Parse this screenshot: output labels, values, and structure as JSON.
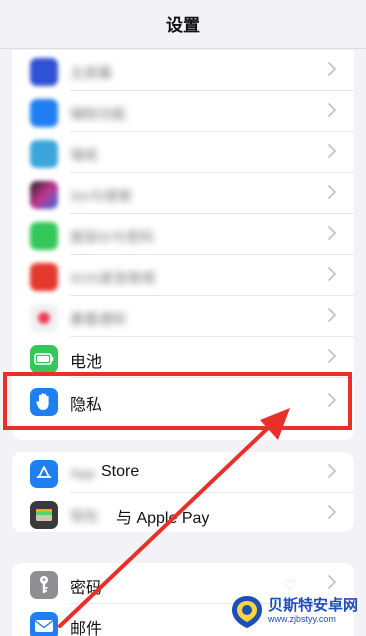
{
  "nav": {
    "title": "设置"
  },
  "group1": {
    "rows": [
      {
        "label": "主屏幕",
        "blurred": true,
        "icon": "home-screen-icon",
        "color": "#2f52d4"
      },
      {
        "label": "辅助功能",
        "blurred": true,
        "icon": "accessibility-icon",
        "color": "#1f7ff1"
      },
      {
        "label": "墙纸",
        "blurred": true,
        "icon": "wallpaper-icon",
        "color": "#3aa6dc"
      },
      {
        "label": "Siri与搜索",
        "blurred": true,
        "icon": "siri-icon",
        "color": "#222222"
      },
      {
        "label": "面容ID与密码",
        "blurred": true,
        "icon": "face-id-icon",
        "color": "#34c759"
      },
      {
        "label": "SOS紧急联络",
        "blurred": true,
        "icon": "sos-icon",
        "color": "#e5392e"
      },
      {
        "label": "暴露通知",
        "blurred": true,
        "icon": "exposure-notification-icon",
        "color": "#f1f1f1"
      },
      {
        "label": "电池",
        "blurred": false,
        "icon": "battery-icon",
        "color": "#34c759"
      },
      {
        "label": "隐私",
        "blurred": false,
        "icon": "privacy-hand-icon",
        "color": "#1f7ff1"
      }
    ]
  },
  "group2": {
    "rows": [
      {
        "label_blur": "App",
        "label": "Store",
        "icon": "app-store-icon",
        "color": "#1f7ff1"
      },
      {
        "label_blur": "钱包",
        "label": "与 Apple Pay",
        "icon": "wallet-icon",
        "color": "#3a3a3a"
      }
    ]
  },
  "group3": {
    "rows": [
      {
        "label": "密码",
        "icon": "key-icon",
        "color": "#8e8e93"
      },
      {
        "label": "邮件",
        "icon": "mail-icon",
        "color": "#1f7ff1"
      }
    ]
  },
  "watermark": {
    "title": "贝斯特安卓网",
    "url": "www.zjbstyy.com"
  },
  "colors": {
    "highlight": "#e8302a",
    "background": "#f2f2f7"
  }
}
